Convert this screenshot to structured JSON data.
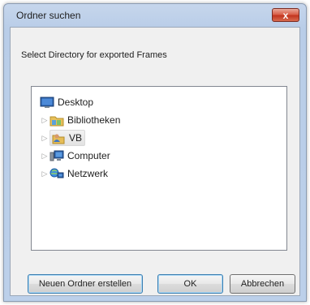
{
  "dialog": {
    "title": "Ordner suchen",
    "close_symbol": "x",
    "prompt": "Select Directory for exported Frames"
  },
  "tree": {
    "items": [
      {
        "label": "Desktop",
        "icon": "desktop-icon",
        "expandable": false
      },
      {
        "label": "Bibliotheken",
        "icon": "libraries-icon",
        "expandable": true
      },
      {
        "label": "VB",
        "icon": "user-folder-icon",
        "expandable": true,
        "selected": true
      },
      {
        "label": "Computer",
        "icon": "computer-icon",
        "expandable": true
      },
      {
        "label": "Netzwerk",
        "icon": "network-icon",
        "expandable": true
      }
    ],
    "expander_symbol": "▷"
  },
  "buttons": {
    "new_folder": "Neuen Ordner erstellen",
    "ok": "OK",
    "cancel": "Abbrechen"
  },
  "colors": {
    "title_bar": "#bcd0ea",
    "close_button": "#c9452f",
    "focus_border": "#3c7fb1"
  }
}
